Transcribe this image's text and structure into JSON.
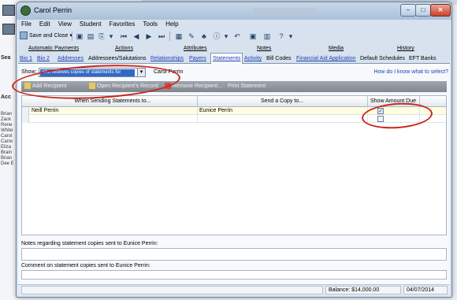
{
  "background": {
    "side_labels": [
      "Sea",
      "Acc"
    ],
    "side_names": [
      "Brian",
      "Zack",
      "Rene",
      "White",
      "Carol",
      "Carre",
      "Eliza",
      "Brain",
      "Brian",
      "Dee E"
    ]
  },
  "window": {
    "title": "Carol Perrin"
  },
  "menu": [
    "File",
    "Edit",
    "View",
    "Student",
    "Favorites",
    "Tools",
    "Help"
  ],
  "toolbar": {
    "save_close": "Save and Close",
    "icons": [
      "disk-icon",
      "print-icon",
      "copy-icon",
      "first-icon",
      "prev-icon",
      "next-icon",
      "last-icon",
      "calc-icon",
      "tools-icon",
      "tree-icon",
      "info-icon",
      "undo-icon",
      "image-icon",
      "card-icon",
      "help-icon"
    ]
  },
  "tabs_row1": [
    "Automatic Payments",
    "Actions",
    "Attributes",
    "Notes",
    "Media",
    "History"
  ],
  "tabs_row2": [
    "Bio 1",
    "Bio 2",
    "Addresses",
    "Addressees/Salutations",
    "Relationships",
    "Payers",
    "Statements",
    "Activity",
    "Bill Codes",
    "Financial Aid Application",
    "Default Schedules",
    "EFT Banks"
  ],
  "selected_tab": "Statements",
  "show": {
    "label": "Show:",
    "value": "who receives copies of statements for",
    "owner": "Carol Perrin",
    "help_link": "How do I know what to select?"
  },
  "actions": {
    "add": "Add Recipient",
    "open": "Open Recipient's Record",
    "remove": "Remove Recipient...",
    "print": "Print Statement"
  },
  "grid": {
    "headers": [
      "When Sending Statements to...",
      "Send a Copy to...",
      "Show Amount Due"
    ],
    "rows": [
      {
        "sending_to": "Neill Perrin",
        "copy_to": "Eunice Perrin",
        "show_amount": true
      }
    ]
  },
  "notes": {
    "label": "Notes regarding statement copies sent to Eunice Perrin:",
    "value": ""
  },
  "comment": {
    "label": "Comment on statement copies sent to Eunice Perrin:",
    "value": ""
  },
  "status": {
    "balance": "Balance: $14,000.00",
    "date": "04/07/2014"
  }
}
